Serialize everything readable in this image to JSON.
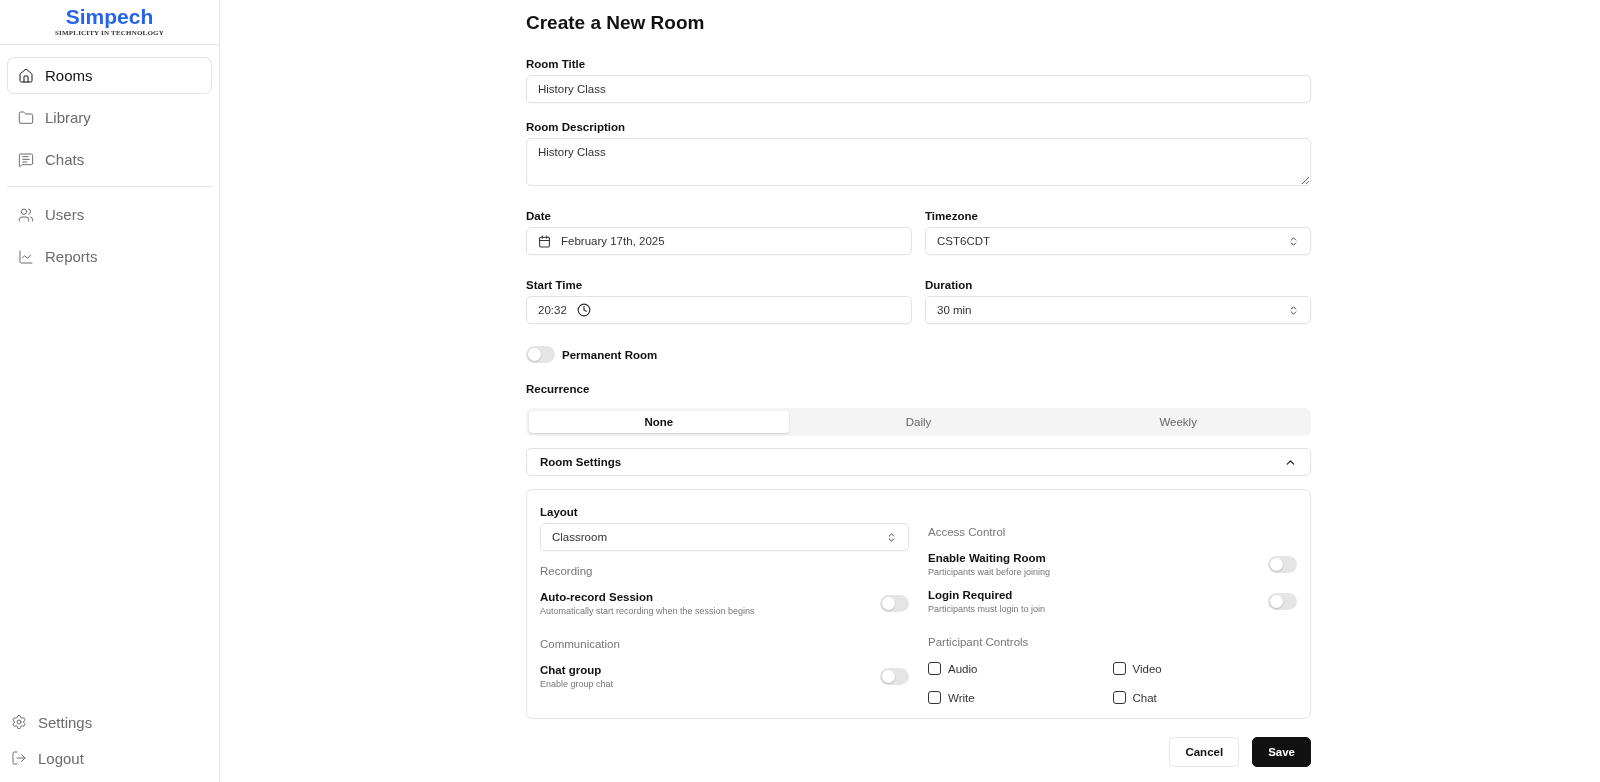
{
  "sidebar": {
    "logo": {
      "name": "Simpech",
      "tagline": "SIMPLICITY IN TECHNOLOGY"
    },
    "groups": [
      [
        {
          "label": "Rooms",
          "kind": "home",
          "selected": true
        },
        {
          "label": "Library",
          "kind": "folder",
          "selected": false
        },
        {
          "label": "Chats",
          "kind": "chat",
          "selected": false
        }
      ],
      [
        {
          "label": "Users",
          "kind": "users",
          "selected": false
        },
        {
          "label": "Reports",
          "kind": "chart",
          "selected": false
        }
      ]
    ],
    "footer": [
      {
        "label": "Settings",
        "kind": "settings"
      },
      {
        "label": "Logout",
        "kind": "logout"
      }
    ]
  },
  "form": {
    "title": "Create a New Room",
    "room_title": {
      "label": "Room Title",
      "value": "History Class"
    },
    "room_description": {
      "label": "Room Description",
      "value": "History Class"
    },
    "date": {
      "label": "Date",
      "value": "February 17th, 2025"
    },
    "timezone": {
      "label": "Timezone",
      "value": "CST6CDT"
    },
    "start_time": {
      "label": "Start Time",
      "value": "20:32"
    },
    "duration": {
      "label": "Duration",
      "value": "30 min"
    },
    "permanent_room": {
      "label": "Permanent Room",
      "on": false
    },
    "recurrence": {
      "label": "Recurrence",
      "options": [
        {
          "label": "None",
          "selected": true
        },
        {
          "label": "Daily",
          "selected": false
        },
        {
          "label": "Weekly",
          "selected": false
        }
      ]
    },
    "room_settings": {
      "title": "Room Settings",
      "expanded": true,
      "columns": [
        [
          {
            "kind": "select",
            "label": "Layout",
            "value": "Classroom"
          },
          {
            "kind": "heading",
            "label": "Recording"
          },
          {
            "kind": "toggle",
            "label": "Auto-record Session",
            "hint": "Automatically start recording when the session begins",
            "on": false
          },
          {
            "kind": "heading",
            "label": "Communication"
          },
          {
            "kind": "toggle",
            "label": "Chat group",
            "hint": "Enable group chat",
            "on": false
          }
        ],
        [
          {
            "kind": "heading",
            "label": "Access Control"
          },
          {
            "kind": "toggle",
            "label": "Enable Waiting Room",
            "hint": "Participants wait before joining",
            "on": false
          },
          {
            "kind": "toggle",
            "label": "Login Required",
            "hint": "Participants must login to join",
            "on": false
          },
          {
            "kind": "heading",
            "label": "Participant Controls"
          },
          {
            "kind": "checkboxes",
            "items": [
              {
                "label": "Audio",
                "checked": false
              },
              {
                "label": "Video",
                "checked": false
              },
              {
                "label": "Write",
                "checked": false
              },
              {
                "label": "Chat",
                "checked": false
              }
            ]
          }
        ]
      ]
    },
    "buttons": [
      {
        "label": "Cancel",
        "kind": "secondary"
      },
      {
        "label": "Save",
        "kind": "primary"
      }
    ]
  }
}
